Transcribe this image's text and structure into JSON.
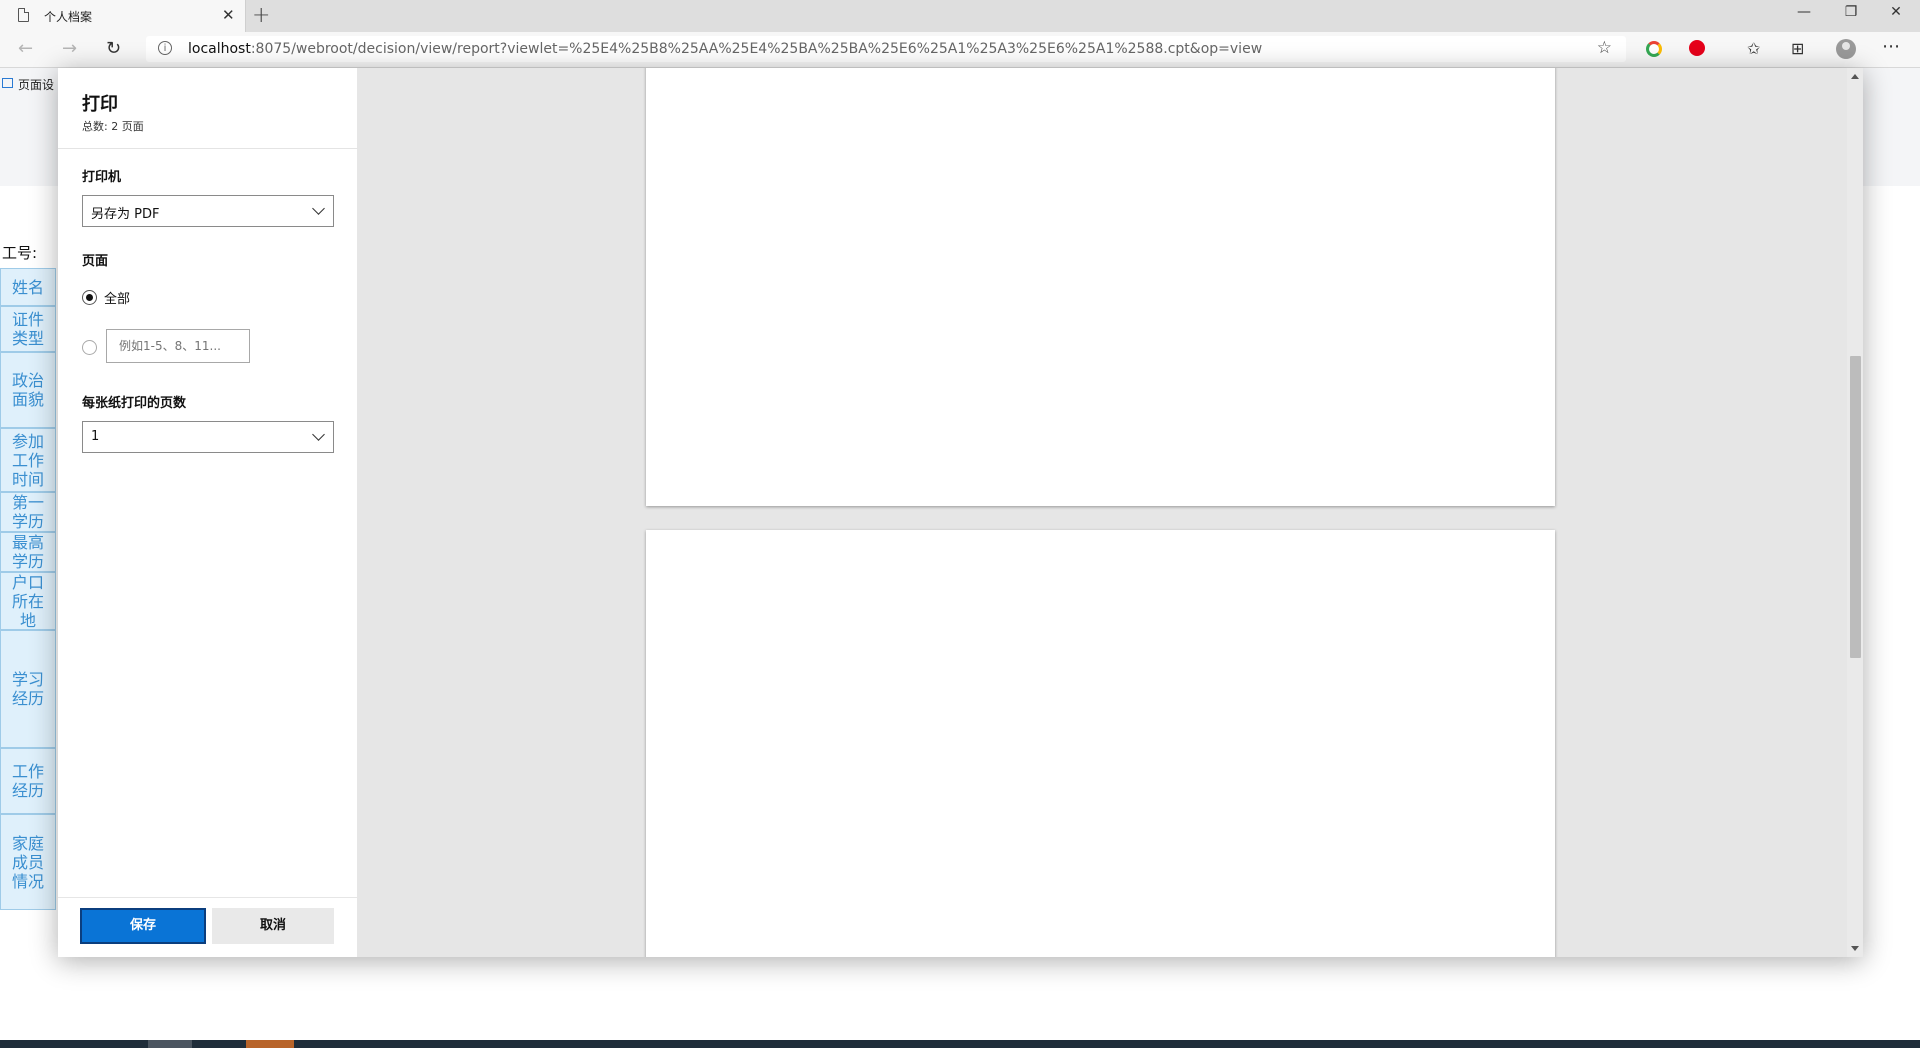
{
  "browser": {
    "tab_title": "个人档案",
    "url_host": "localhost",
    "url_rest": ":8075/webroot/decision/view/report?viewlet=%25E4%25B8%25AA%25E4%25BA%25BA%25E6%25A1%25A3%25E6%25A1%2588.cpt&op=view",
    "icons": {
      "close": "✕",
      "new_tab": "+",
      "minimize": "—",
      "restore": "❐",
      "window_close": "✕",
      "back": "←",
      "forward": "→",
      "reload": "↻",
      "info": "i",
      "favorite": "☆",
      "favorites": "✩",
      "collections": "⊞",
      "menu": "⋯"
    },
    "extension_colors": [
      "#4285f4",
      "#e6001a"
    ]
  },
  "page": {
    "toolbar_label": "页面设",
    "work_no_label": "工号:",
    "side_labels": [
      "姓名",
      "证件类型",
      "政治面貌",
      "参加工作时间",
      "第一学历",
      "最高学历",
      "户口所在地",
      "学习经历",
      "工作经历",
      "家庭成员情况"
    ]
  },
  "print": {
    "title": "打印",
    "total": "总数: 2 页面",
    "printer_label": "打印机",
    "printer_value": "另存为 PDF",
    "pages_label": "页面",
    "pages_all": "全部",
    "pages_range_placeholder": "例如1-5、8、11...",
    "pages_per_sheet_label": "每张纸打印的页数",
    "pages_per_sheet_value": "1",
    "save_label": "保存",
    "cancel_label": "取消"
  },
  "colors": {
    "accent": "#0a74d6",
    "side_cell_bg": "#dff0fb",
    "side_cell_text": "#3a8fd0"
  }
}
